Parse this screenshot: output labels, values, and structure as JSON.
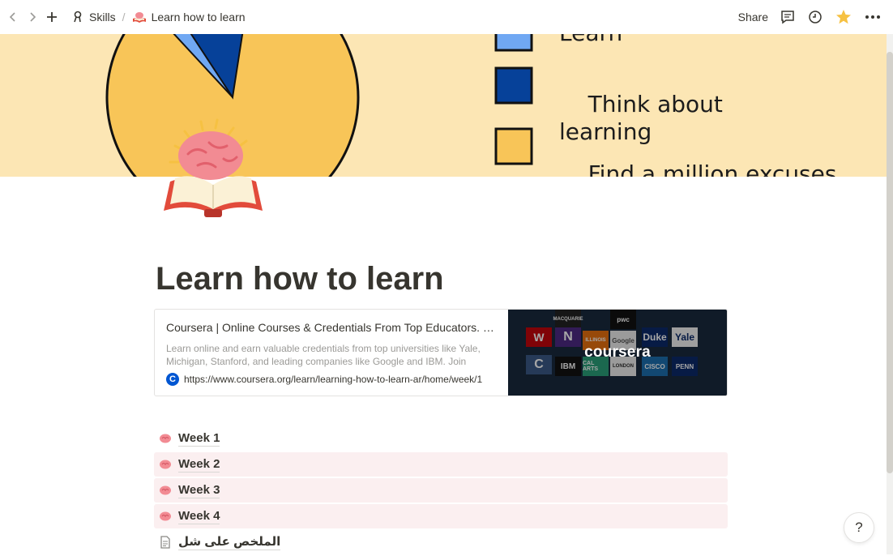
{
  "topbar": {
    "breadcrumb": [
      {
        "label": "Skills",
        "icon": "skills-icon"
      },
      {
        "label": "Learn how to learn",
        "icon": "brain-book-icon"
      }
    ],
    "share_label": "Share"
  },
  "cover": {
    "legend": [
      "Learn",
      "Think about\nlearning",
      "Find a million excuses\nwhy I don't have the"
    ],
    "colors": {
      "light_blue": "#70a8f3",
      "dark_blue": "#064199",
      "yellow": "#f8c558",
      "bg": "#fce6b4"
    }
  },
  "page": {
    "title": "Learn how to learn"
  },
  "bookmark": {
    "title": "Coursera | Online Courses & Credentials From Top Educators. Join for Free | Coursera",
    "description": "Learn online and earn valuable credentials from top universities like Yale, Michigan, Stanford, and leading companies like Google and IBM. Join Coursera",
    "url": "https://www.coursera.org/learn/learning-how-to-learn-ar/home/week/1",
    "favicon_letter": "C",
    "image_brand": "coursera",
    "tiles": [
      "MACQUARIE",
      "pwc",
      "ILLINOIS",
      "Google",
      "Duke",
      "Yale",
      "N",
      "W",
      "C",
      "IBM",
      "CAL ARTS",
      "CISCO",
      "LONDON",
      "PENN"
    ]
  },
  "list": [
    {
      "label": "Week 1",
      "icon": "brain-icon",
      "highlight": false
    },
    {
      "label": "Week 2",
      "icon": "brain-icon",
      "highlight": true
    },
    {
      "label": "Week 3",
      "icon": "brain-icon",
      "highlight": true
    },
    {
      "label": "Week 4",
      "icon": "brain-icon",
      "highlight": true
    },
    {
      "label": "الملخص على شل",
      "icon": "document-icon",
      "highlight": false
    }
  ],
  "help_label": "?"
}
